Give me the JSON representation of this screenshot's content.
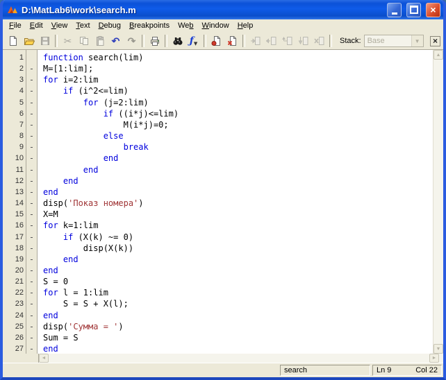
{
  "window": {
    "title": "D:\\MatLab6\\work\\search.m"
  },
  "menu": {
    "items": [
      {
        "label": "File",
        "u": 0
      },
      {
        "label": "Edit",
        "u": 0
      },
      {
        "label": "View",
        "u": 0
      },
      {
        "label": "Text",
        "u": 0
      },
      {
        "label": "Debug",
        "u": 0
      },
      {
        "label": "Breakpoints",
        "u": 0
      },
      {
        "label": "Web",
        "u": 2
      },
      {
        "label": "Window",
        "u": 0
      },
      {
        "label": "Help",
        "u": 0
      }
    ]
  },
  "toolbar": {
    "stack_label": "Stack:",
    "stack_value": "Base",
    "items": [
      {
        "icon": "new-file",
        "enabled": true
      },
      {
        "icon": "open-file",
        "enabled": true
      },
      {
        "icon": "save-file",
        "enabled": false
      },
      {
        "sep": true
      },
      {
        "icon": "cut",
        "enabled": false
      },
      {
        "icon": "copy",
        "enabled": false
      },
      {
        "icon": "paste",
        "enabled": false
      },
      {
        "icon": "undo",
        "enabled": true
      },
      {
        "icon": "redo",
        "enabled": false
      },
      {
        "sep": true
      },
      {
        "icon": "print",
        "enabled": true
      },
      {
        "sep": true
      },
      {
        "icon": "find",
        "enabled": true
      },
      {
        "icon": "function-browser",
        "enabled": true
      },
      {
        "sep": true
      },
      {
        "icon": "set-clear-breakpoint",
        "enabled": true
      },
      {
        "icon": "clear-all-breakpoints",
        "enabled": true
      },
      {
        "sep": true
      },
      {
        "icon": "step-in",
        "enabled": false
      },
      {
        "icon": "step-over",
        "enabled": false
      },
      {
        "icon": "step-out",
        "enabled": false
      },
      {
        "icon": "go-until-cursor",
        "enabled": false
      },
      {
        "icon": "quit-debugging",
        "enabled": false
      },
      {
        "sep": true
      }
    ]
  },
  "editor": {
    "lines": [
      {
        "n": "1",
        "d": "",
        "s": [
          [
            "k",
            "function"
          ],
          [
            "p",
            " search(lim)"
          ]
        ]
      },
      {
        "n": "2",
        "d": "-",
        "s": [
          [
            "p",
            "M=[1:lim];"
          ]
        ]
      },
      {
        "n": "3",
        "d": "-",
        "s": [
          [
            "k",
            "for"
          ],
          [
            "p",
            " i=2:lim"
          ]
        ]
      },
      {
        "n": "4",
        "d": "-",
        "s": [
          [
            "p",
            "    "
          ],
          [
            "k",
            "if"
          ],
          [
            "p",
            " (i^2<=lim)"
          ]
        ]
      },
      {
        "n": "5",
        "d": "-",
        "s": [
          [
            "p",
            "        "
          ],
          [
            "k",
            "for"
          ],
          [
            "p",
            " (j=2:lim)"
          ]
        ]
      },
      {
        "n": "6",
        "d": "-",
        "s": [
          [
            "p",
            "            "
          ],
          [
            "k",
            "if"
          ],
          [
            "p",
            " ((i*j)<=lim)"
          ]
        ]
      },
      {
        "n": "7",
        "d": "-",
        "s": [
          [
            "p",
            "                M(i*j)=0;"
          ]
        ]
      },
      {
        "n": "8",
        "d": "-",
        "s": [
          [
            "p",
            "            "
          ],
          [
            "k",
            "else"
          ]
        ]
      },
      {
        "n": "9",
        "d": "-",
        "s": [
          [
            "p",
            "                "
          ],
          [
            "k",
            "break"
          ]
        ]
      },
      {
        "n": "10",
        "d": "-",
        "s": [
          [
            "p",
            "            "
          ],
          [
            "k",
            "end"
          ]
        ]
      },
      {
        "n": "11",
        "d": "-",
        "s": [
          [
            "p",
            "        "
          ],
          [
            "k",
            "end"
          ]
        ]
      },
      {
        "n": "12",
        "d": "-",
        "s": [
          [
            "p",
            "    "
          ],
          [
            "k",
            "end"
          ]
        ]
      },
      {
        "n": "13",
        "d": "-",
        "s": [
          [
            "k",
            "end"
          ]
        ]
      },
      {
        "n": "14",
        "d": "-",
        "s": [
          [
            "p",
            "disp("
          ],
          [
            "s2",
            "'Показ номера'"
          ],
          [
            "p",
            ")"
          ]
        ]
      },
      {
        "n": "15",
        "d": "-",
        "s": [
          [
            "p",
            "X=M"
          ]
        ]
      },
      {
        "n": "16",
        "d": "-",
        "s": [
          [
            "k",
            "for"
          ],
          [
            "p",
            " k=1:lim"
          ]
        ]
      },
      {
        "n": "17",
        "d": "-",
        "s": [
          [
            "p",
            "    "
          ],
          [
            "k",
            "if"
          ],
          [
            "p",
            " (X(k) ~= 0)"
          ]
        ]
      },
      {
        "n": "18",
        "d": "-",
        "s": [
          [
            "p",
            "        disp(X(k))"
          ]
        ]
      },
      {
        "n": "19",
        "d": "-",
        "s": [
          [
            "p",
            "    "
          ],
          [
            "k",
            "end"
          ]
        ]
      },
      {
        "n": "20",
        "d": "-",
        "s": [
          [
            "k",
            "end"
          ]
        ]
      },
      {
        "n": "21",
        "d": "-",
        "s": [
          [
            "p",
            "S = 0"
          ]
        ]
      },
      {
        "n": "22",
        "d": "-",
        "s": [
          [
            "k",
            "for"
          ],
          [
            "p",
            " l = 1:lim"
          ]
        ]
      },
      {
        "n": "23",
        "d": "-",
        "s": [
          [
            "p",
            "    S = S + X(l);"
          ]
        ]
      },
      {
        "n": "24",
        "d": "-",
        "s": [
          [
            "k",
            "end"
          ]
        ]
      },
      {
        "n": "25",
        "d": "-",
        "s": [
          [
            "p",
            "disp("
          ],
          [
            "s2",
            "'Сумма = '"
          ],
          [
            "p",
            ")"
          ]
        ]
      },
      {
        "n": "26",
        "d": "-",
        "s": [
          [
            "p",
            "Sum = S"
          ]
        ]
      },
      {
        "n": "27",
        "d": "-",
        "s": [
          [
            "k",
            "end"
          ]
        ]
      }
    ]
  },
  "statusbar": {
    "function_name": "search",
    "line": "Ln 9",
    "col": "Col 22"
  },
  "colors": {
    "keyword": "#0000dd",
    "string": "#a03536",
    "titlebar_blue": "#0f5be8",
    "chrome": "#ece9d8"
  }
}
